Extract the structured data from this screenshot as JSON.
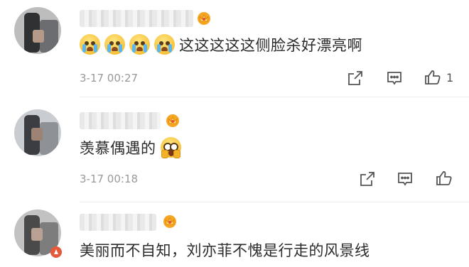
{
  "comments": [
    {
      "text": "这这这这这侧脸杀好漂亮啊",
      "emojis": [
        "crying-face",
        "crying-face",
        "crying-face",
        "crying-face"
      ],
      "timestamp": "3-17 00:27",
      "like_count": "1"
    },
    {
      "text": "羡慕偶遇的",
      "emojis": [
        "shocked-face"
      ],
      "timestamp": "3-17 00:18",
      "like_count": ""
    },
    {
      "text": "美丽而不自知，刘亦菲不愧是行走的风景线",
      "emojis": [],
      "timestamp": "",
      "like_count": ""
    }
  ],
  "icons": {
    "share": "share-icon",
    "reply": "comment-icon",
    "like": "thumbs-up-icon",
    "badge": "crown-badge-icon"
  },
  "colors": {
    "text": "#2b2b2b",
    "meta": "#999999",
    "icon": "#555555",
    "divider": "#ececec",
    "badge": "#f5a623"
  }
}
